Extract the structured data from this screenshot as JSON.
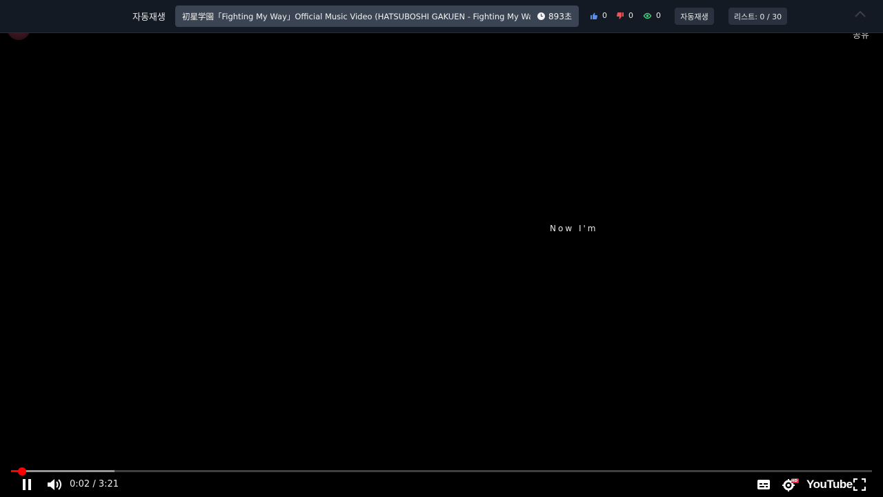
{
  "underlay": {
    "share_label": "공유"
  },
  "toolbar": {
    "autoplay_label": "자동재생",
    "video_title": "初星学園「Fighting My Way」Official Music Video (HATSUBOSHI GAKUEN - Fighting My Way)",
    "timer_value": "893초",
    "likes": "0",
    "dislikes": "0",
    "views": "0",
    "autoplay_button": "자동재생",
    "list_counter": "리스트: 0 / 30",
    "colors": {
      "like": "#5b8def",
      "dislike": "#e5565a",
      "view": "#3ccf7a"
    }
  },
  "video": {
    "lyric": "Now I'm"
  },
  "player": {
    "time_display": "0:02 / 3:21",
    "played_fraction": 0.01,
    "buffered_fraction": 0.12,
    "quality_badge": "HD",
    "brand": "YouTube",
    "icons": [
      "pause-icon",
      "volume-icon",
      "subtitles-icon",
      "settings-icon",
      "fullscreen-icon"
    ]
  }
}
